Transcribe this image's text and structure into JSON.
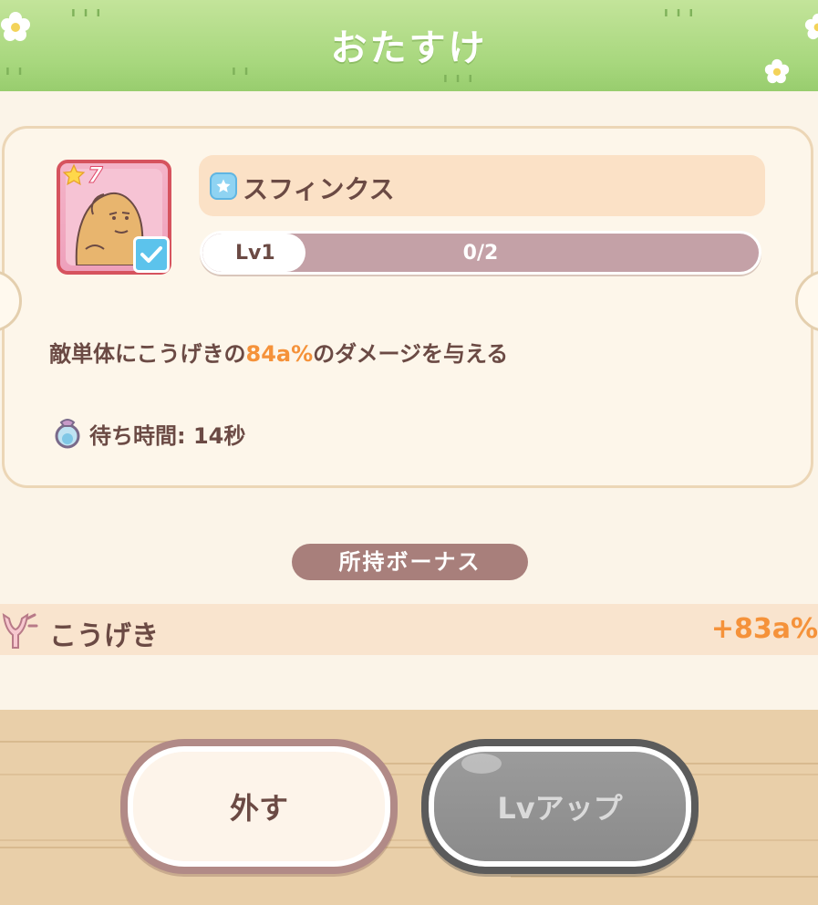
{
  "header": {
    "title": "おたすけ"
  },
  "card": {
    "rarity": "7",
    "name": "スフィンクス",
    "level_label": "Lv1",
    "level_progress": "0/2",
    "progress_fraction": 0.0,
    "description_pre": "敵単体にこうげきの",
    "description_value": "84a%",
    "description_post": "のダメージを与える",
    "cooldown": "待ち時間: 14秒"
  },
  "bonus": {
    "section_title": "所持ボーナス",
    "stat_label": "こうげき",
    "stat_value": "+83a%"
  },
  "buttons": {
    "remove_label": "外す",
    "levelup_label": "Lvアップ"
  },
  "colors": {
    "header_green": "#a7d77d",
    "text_brown": "#6b4a44",
    "accent_orange": "#f5923a",
    "card_frame_red": "#d6535e",
    "check_blue": "#5cc3ec",
    "disabled_gray": "#8a8a8a"
  },
  "icons": [
    "star-icon",
    "check-icon",
    "character-type-icon",
    "timer-icon",
    "attack-icon"
  ]
}
